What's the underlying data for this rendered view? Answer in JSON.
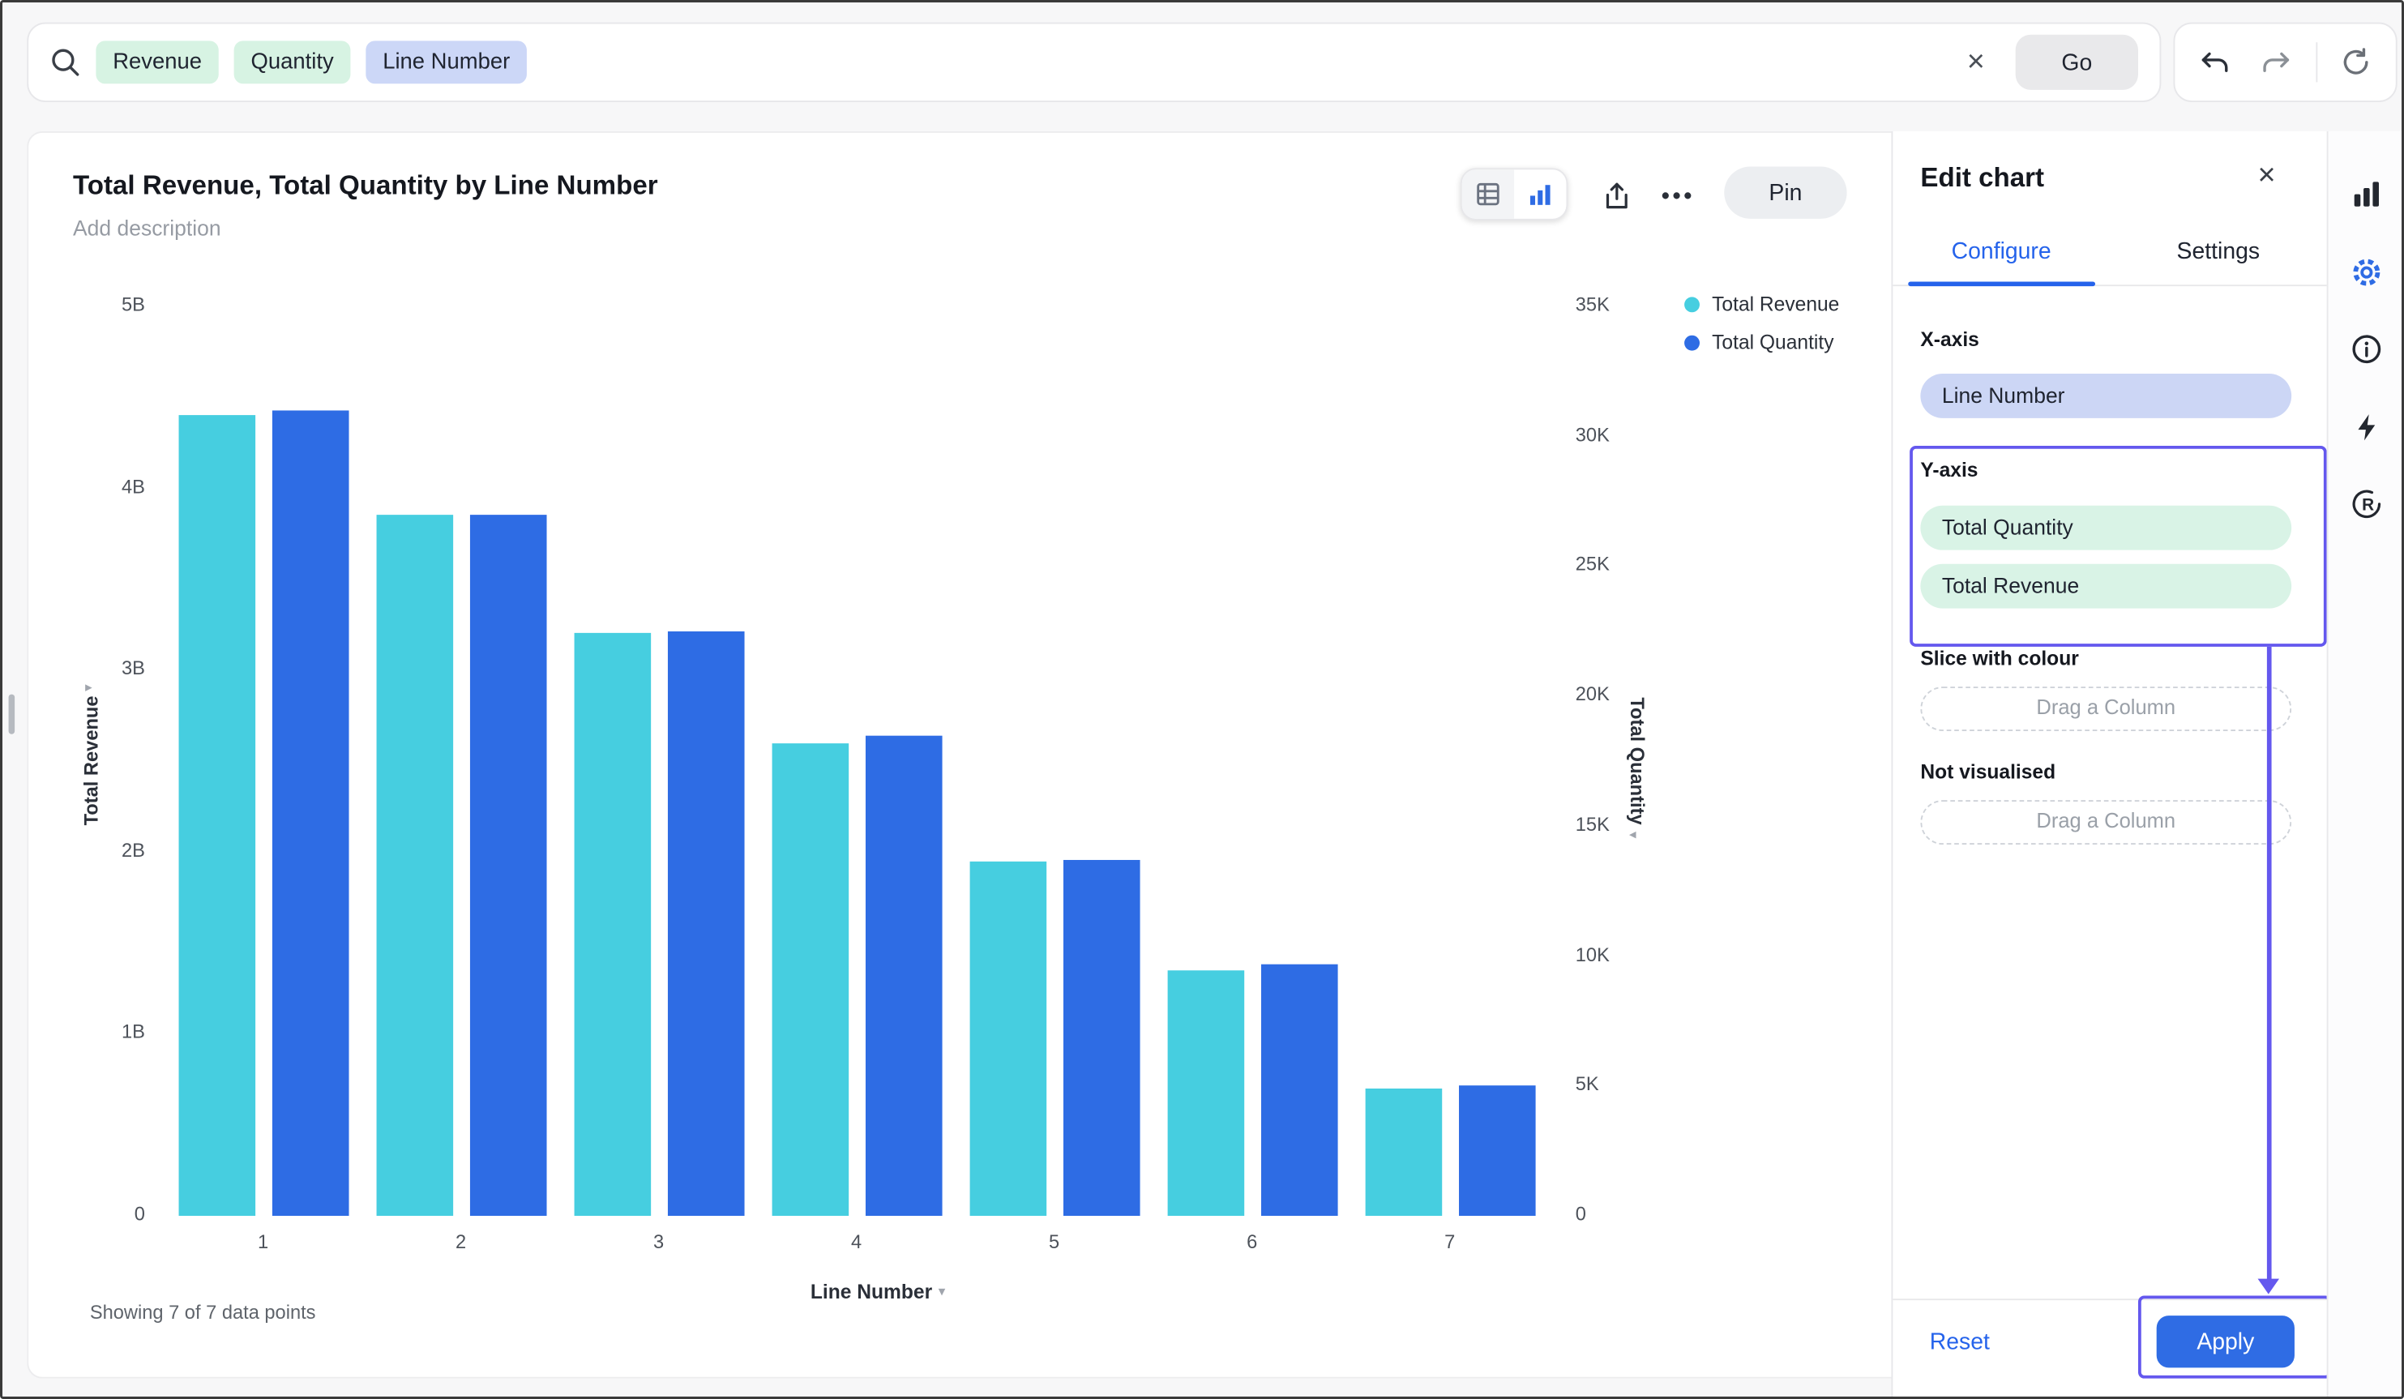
{
  "search": {
    "tokens": [
      {
        "label": "Revenue",
        "type": "green"
      },
      {
        "label": "Quantity",
        "type": "green"
      },
      {
        "label": "Line Number",
        "type": "blue"
      }
    ],
    "go_label": "Go"
  },
  "chart_card": {
    "title": "Total Revenue, Total Quantity by Line Number",
    "description_placeholder": "Add description",
    "pin_label": "Pin",
    "footer": "Showing 7 of 7 data points"
  },
  "chart_data": {
    "type": "bar",
    "title": "Total Revenue, Total Quantity by Line Number",
    "categories": [
      "1",
      "2",
      "3",
      "4",
      "5",
      "6",
      "7"
    ],
    "series": [
      {
        "name": "Total Revenue",
        "axis": "left",
        "color": "#46CEE0",
        "unit": "billions",
        "values": [
          4.4,
          3.85,
          3.2,
          2.6,
          1.95,
          1.35,
          0.7
        ]
      },
      {
        "name": "Total Quantity",
        "axis": "right",
        "color": "#2E6CE4",
        "unit": "thousands",
        "values": [
          31,
          27,
          22.5,
          18.5,
          13.7,
          9.7,
          5
        ]
      }
    ],
    "left_axis": {
      "label": "Total Revenue",
      "ticks": [
        "5B",
        "4B",
        "3B",
        "2B",
        "1B",
        "0"
      ],
      "max": 5
    },
    "right_axis": {
      "label": "Total Quantity",
      "ticks": [
        "35K",
        "30K",
        "25K",
        "20K",
        "15K",
        "10K",
        "5K",
        "0"
      ],
      "max": 35
    },
    "x_axis": {
      "label": "Line Number"
    },
    "legend": [
      {
        "label": "Total Revenue",
        "color": "#46CEE0"
      },
      {
        "label": "Total Quantity",
        "color": "#2E6CE4"
      }
    ],
    "grid": false,
    "legend_position": "top-right"
  },
  "edit_panel": {
    "title": "Edit chart",
    "tabs": [
      {
        "label": "Configure",
        "active": true
      },
      {
        "label": "Settings",
        "active": false
      }
    ],
    "sections": {
      "x_axis": {
        "label": "X-axis",
        "pills": [
          {
            "label": "Line Number",
            "type": "blue"
          }
        ]
      },
      "y_axis": {
        "label": "Y-axis",
        "pills": [
          {
            "label": "Total Quantity",
            "type": "green"
          },
          {
            "label": "Total Revenue",
            "type": "green"
          }
        ]
      },
      "slice": {
        "label": "Slice with colour",
        "placeholder": "Drag a Column"
      },
      "not_visualised": {
        "label": "Not visualised",
        "placeholder": "Drag a Column"
      }
    },
    "reset_label": "Reset",
    "apply_label": "Apply"
  },
  "annotations": {
    "color": "#6458ee"
  }
}
